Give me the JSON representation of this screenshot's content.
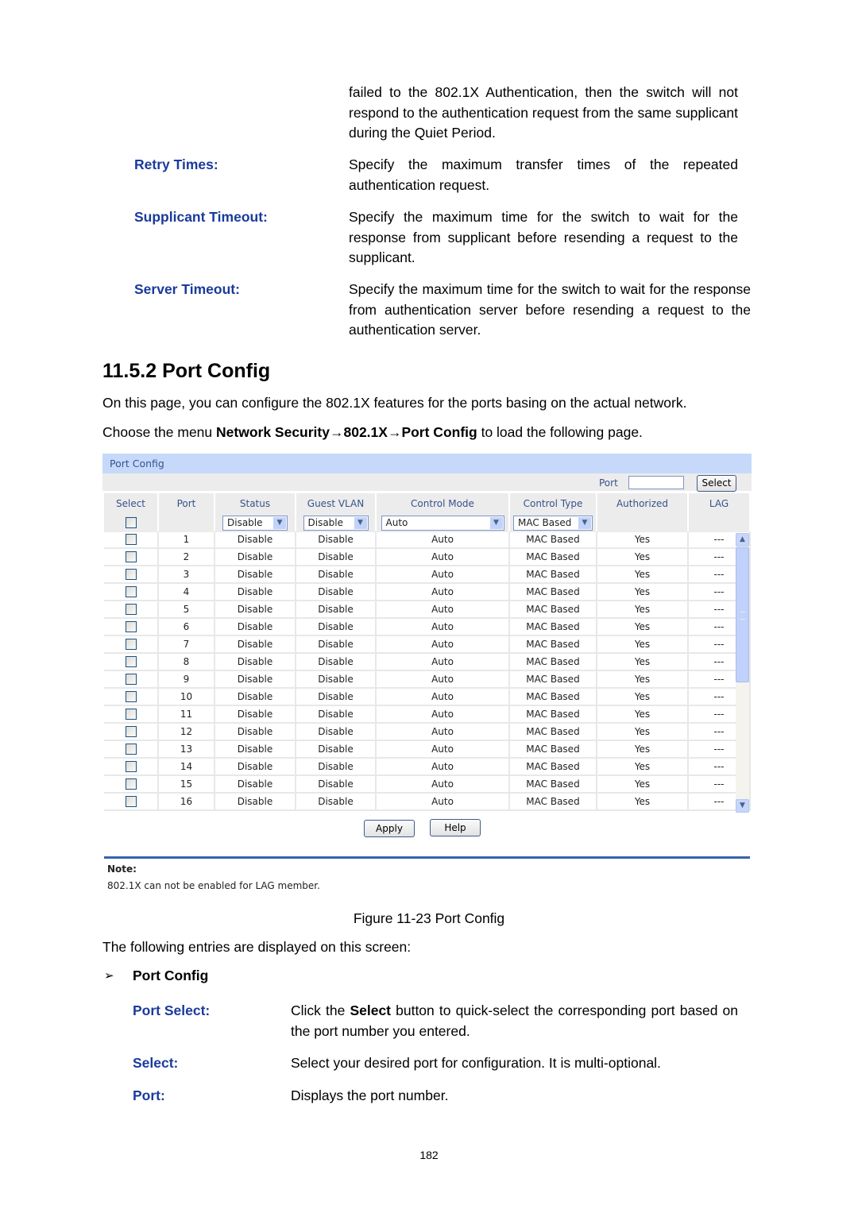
{
  "document": {
    "intro_continuation": "failed to the 802.1X Authentication, then the switch will not respond to the authentication request from the same supplicant during the Quiet Period.",
    "definitions_top": [
      {
        "term": "Retry Times:",
        "text": "Specify the maximum transfer times of the repeated authentication request."
      },
      {
        "term": "Supplicant Timeout:",
        "text": "Specify the maximum time for the switch to wait for the response from supplicant before resending a request to the supplicant."
      },
      {
        "term": "Server Timeout:",
        "text": "Specify the maximum time for the switch to wait for the response from authentication server before resending a request to the authentication server."
      }
    ],
    "section_heading": "11.5.2  Port Config",
    "section_intro": "On this page, you can configure the 802.1X features for the ports basing on the actual network.",
    "menu_path": {
      "prefix": "Choose the menu ",
      "path": "Network Security→802.1X→Port Config",
      "suffix": " to load the following page."
    },
    "figure_caption": "Figure 11-23 Port Config",
    "entries_intro": "The following entries are displayed on this screen:",
    "subsection": {
      "bullet": "➢",
      "title": "Port Config"
    },
    "definitions_bottom": [
      {
        "term": "Port Select:",
        "text_pre": "Click the ",
        "text_bold": "Select",
        "text_post": " button to quick-select the corresponding port based on the port number you entered."
      },
      {
        "term": "Select:",
        "text": "Select your desired port for configuration. It is multi-optional."
      },
      {
        "term": "Port:",
        "text": "Displays the port number."
      }
    ],
    "page_number": "182"
  },
  "ui": {
    "panel_title": "Port Config",
    "port_label": "Port",
    "port_input_value": "",
    "select_button": "Select",
    "columns": [
      "Select",
      "Port",
      "Status",
      "Guest VLAN",
      "Control Mode",
      "Control Type",
      "Authorized",
      "LAG"
    ],
    "controls": {
      "status": "Disable",
      "guest_vlan": "Disable",
      "control_mode": "Auto",
      "control_type": "MAC Based"
    },
    "rows": [
      {
        "port": "1",
        "status": "Disable",
        "guest_vlan": "Disable",
        "control_mode": "Auto",
        "control_type": "MAC Based",
        "authorized": "Yes",
        "lag": "---"
      },
      {
        "port": "2",
        "status": "Disable",
        "guest_vlan": "Disable",
        "control_mode": "Auto",
        "control_type": "MAC Based",
        "authorized": "Yes",
        "lag": "---"
      },
      {
        "port": "3",
        "status": "Disable",
        "guest_vlan": "Disable",
        "control_mode": "Auto",
        "control_type": "MAC Based",
        "authorized": "Yes",
        "lag": "---"
      },
      {
        "port": "4",
        "status": "Disable",
        "guest_vlan": "Disable",
        "control_mode": "Auto",
        "control_type": "MAC Based",
        "authorized": "Yes",
        "lag": "---"
      },
      {
        "port": "5",
        "status": "Disable",
        "guest_vlan": "Disable",
        "control_mode": "Auto",
        "control_type": "MAC Based",
        "authorized": "Yes",
        "lag": "---"
      },
      {
        "port": "6",
        "status": "Disable",
        "guest_vlan": "Disable",
        "control_mode": "Auto",
        "control_type": "MAC Based",
        "authorized": "Yes",
        "lag": "---"
      },
      {
        "port": "7",
        "status": "Disable",
        "guest_vlan": "Disable",
        "control_mode": "Auto",
        "control_type": "MAC Based",
        "authorized": "Yes",
        "lag": "---"
      },
      {
        "port": "8",
        "status": "Disable",
        "guest_vlan": "Disable",
        "control_mode": "Auto",
        "control_type": "MAC Based",
        "authorized": "Yes",
        "lag": "---"
      },
      {
        "port": "9",
        "status": "Disable",
        "guest_vlan": "Disable",
        "control_mode": "Auto",
        "control_type": "MAC Based",
        "authorized": "Yes",
        "lag": "---"
      },
      {
        "port": "10",
        "status": "Disable",
        "guest_vlan": "Disable",
        "control_mode": "Auto",
        "control_type": "MAC Based",
        "authorized": "Yes",
        "lag": "---"
      },
      {
        "port": "11",
        "status": "Disable",
        "guest_vlan": "Disable",
        "control_mode": "Auto",
        "control_type": "MAC Based",
        "authorized": "Yes",
        "lag": "---"
      },
      {
        "port": "12",
        "status": "Disable",
        "guest_vlan": "Disable",
        "control_mode": "Auto",
        "control_type": "MAC Based",
        "authorized": "Yes",
        "lag": "---"
      },
      {
        "port": "13",
        "status": "Disable",
        "guest_vlan": "Disable",
        "control_mode": "Auto",
        "control_type": "MAC Based",
        "authorized": "Yes",
        "lag": "---"
      },
      {
        "port": "14",
        "status": "Disable",
        "guest_vlan": "Disable",
        "control_mode": "Auto",
        "control_type": "MAC Based",
        "authorized": "Yes",
        "lag": "---"
      },
      {
        "port": "15",
        "status": "Disable",
        "guest_vlan": "Disable",
        "control_mode": "Auto",
        "control_type": "MAC Based",
        "authorized": "Yes",
        "lag": "---"
      },
      {
        "port": "16",
        "status": "Disable",
        "guest_vlan": "Disable",
        "control_mode": "Auto",
        "control_type": "MAC Based",
        "authorized": "Yes",
        "lag": "---"
      }
    ],
    "apply_button": "Apply",
    "help_button": "Help",
    "note_title": "Note:",
    "note_text": "802.1X can not be enabled for LAG member.",
    "colors": {
      "title_bar": "#c6d9fb",
      "header_text": "#36528c",
      "note_rule": "#3763a8",
      "term_blue": "#1a3a9c"
    }
  }
}
